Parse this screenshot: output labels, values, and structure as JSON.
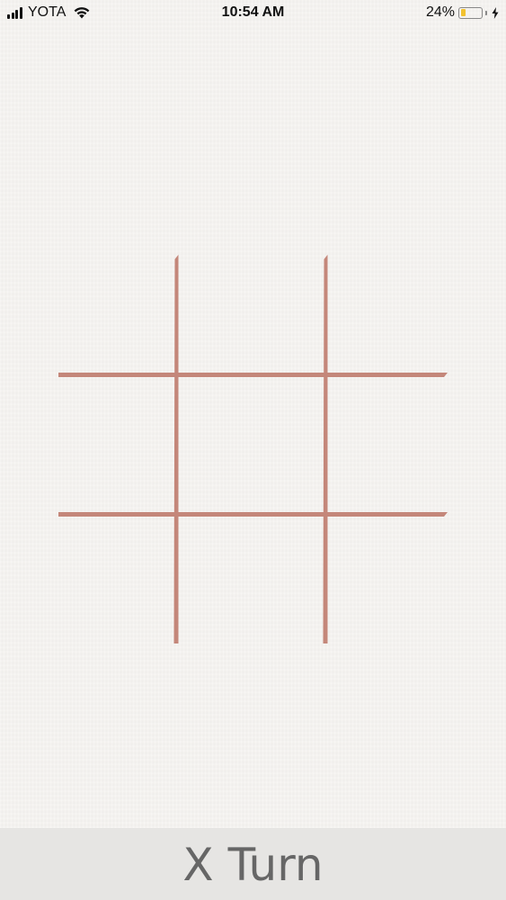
{
  "status_bar": {
    "carrier": "YOTA",
    "time": "10:54 AM",
    "battery_percent": "24%",
    "battery_level": 0.24,
    "charging": true,
    "icons": [
      "signal-icon",
      "wifi-icon",
      "battery-icon",
      "charging-bolt-icon"
    ]
  },
  "game": {
    "type": "tic-tac-toe",
    "board": [
      [
        "",
        "",
        ""
      ],
      [
        "",
        "",
        ""
      ],
      [
        "",
        "",
        ""
      ]
    ],
    "grid_color": "#c4877a",
    "background_color": "#f4f2ef"
  },
  "turn_bar": {
    "label": "X Turn",
    "background_color": "#e6e5e3",
    "text_color": "#666666"
  }
}
